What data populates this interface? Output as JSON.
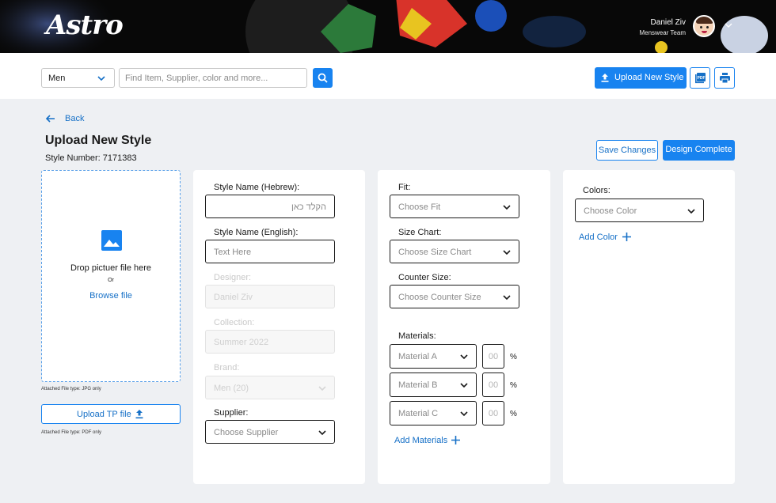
{
  "header": {
    "logo_text": "Astro",
    "user_name": "Daniel Ziv",
    "user_team": "Menswear Team"
  },
  "toolbar": {
    "gender_value": "Men",
    "search_placeholder": "Find Item, Supplier, color and more...",
    "upload_label": "Upload New Style"
  },
  "page": {
    "back_label": "Back",
    "title": "Upload New Style",
    "style_number": "Style Number: 7171383",
    "save_label": "Save Changes",
    "complete_label": "Design Complete"
  },
  "dropzone": {
    "drop_text": "Drop pictuer file here",
    "or_text": "Or",
    "browse_text": "Browse file",
    "attached_note": "Attached File type: JPG only",
    "tp_button": "Upload TP file",
    "tp_note": "Attached File type: PDF only"
  },
  "card1": {
    "hebrew_label": "Style Name (Hebrew):",
    "hebrew_placeholder": "הקלד כאן",
    "english_label": "Style Name (English):",
    "english_placeholder": "Text Here",
    "designer_label": "Designer:",
    "designer_value": "Daniel Ziv",
    "collection_label": "Collection:",
    "collection_value": "Summer 2022",
    "brand_label": "Brand:",
    "brand_value": "Men (20)",
    "supplier_label": "Supplier:",
    "supplier_placeholder": "Choose Supplier"
  },
  "card2": {
    "fit_label": "Fit:",
    "fit_placeholder": "Choose Fit",
    "size_chart_label": "Size Chart:",
    "size_chart_placeholder": "Choose Size Chart",
    "counter_size_label": "Counter Size:",
    "counter_size_placeholder": "Choose Counter Size",
    "materials_label": "Materials:",
    "materials": [
      {
        "name": "Material A",
        "percent": "00"
      },
      {
        "name": "Material B",
        "percent": "00"
      },
      {
        "name": "Material C",
        "percent": "00"
      }
    ],
    "percent_symbol": "%",
    "add_materials": "Add Materials"
  },
  "card3": {
    "colors_label": "Colors:",
    "color_placeholder": "Choose Color",
    "add_color": "Add Color"
  },
  "colors": {
    "accent": "#1883f0",
    "link": "#1670c7",
    "background": "#eef0f3"
  }
}
